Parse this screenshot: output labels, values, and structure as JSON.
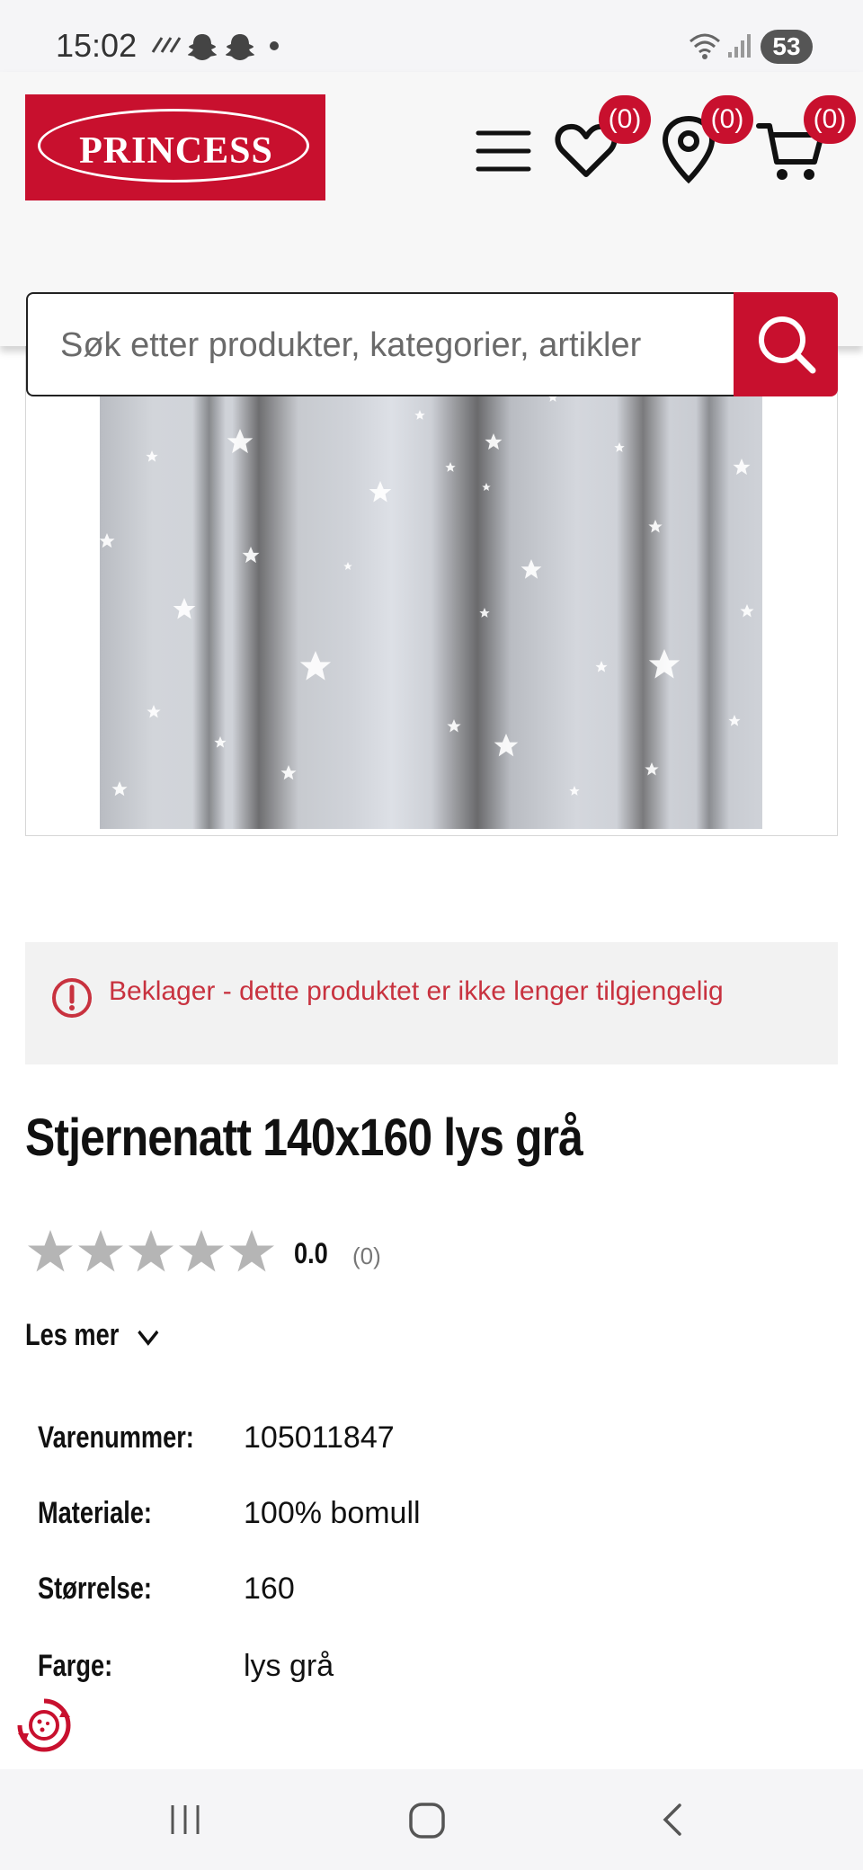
{
  "status_bar": {
    "time": "15:02",
    "battery": "53"
  },
  "header": {
    "logo_text": "PRINCESS",
    "wishlist_count": "(0)",
    "stores_count": "(0)",
    "cart_count": "(0)"
  },
  "search": {
    "placeholder": "Søk etter produkter, kategorier, artikler"
  },
  "alert": {
    "message": "Beklager - dette produktet er ikke lenger tilgjengelig"
  },
  "product": {
    "title": "Stjernenatt 140x160 lys grå",
    "rating_value": "0.0",
    "rating_count": "(0)",
    "rating_stars": 0,
    "read_more_label": "Les mer"
  },
  "specs": [
    {
      "label": "Varenummer:",
      "value": "105011847"
    },
    {
      "label": "Materiale:",
      "value": "100% bomull"
    },
    {
      "label": "Størrelse:",
      "value": "160"
    },
    {
      "label": "Farge:",
      "value": "lys grå"
    }
  ],
  "colors": {
    "brand_red": "#c8102e",
    "alert_text": "#c8323f",
    "star_empty": "#b5b5b5"
  }
}
